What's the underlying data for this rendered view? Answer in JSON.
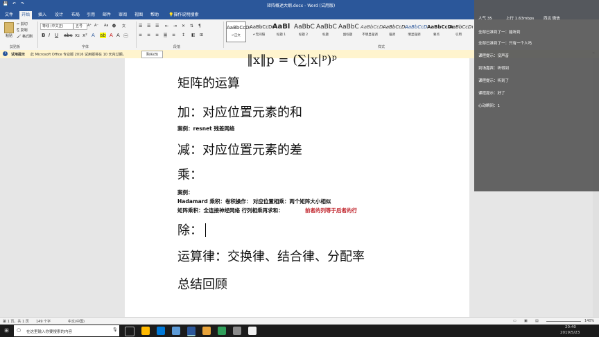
{
  "window": {
    "title": "矩阵概述大纲.docx - Word (试用版)",
    "tabs": [
      "文件",
      "开始",
      "插入",
      "设计",
      "布局",
      "引用",
      "邮件",
      "审阅",
      "视图",
      "帮助",
      "操作说明搜索"
    ],
    "active_tab": "开始"
  },
  "ribbon": {
    "clipboard": {
      "paste": "粘贴",
      "cut": "剪切",
      "copy": "复制",
      "format_painter": "格式刷",
      "group": "剪贴板"
    },
    "font": {
      "name": "等线 (中文正)",
      "size": "五号",
      "group": "字体"
    },
    "paragraph": {
      "group": "段落"
    },
    "styles": {
      "group": "样式",
      "items": [
        {
          "preview": "AaBbCcDı",
          "name": "↵正文"
        },
        {
          "preview": "AaBbCcDı",
          "name": "↵无间隔"
        },
        {
          "preview": "AaBl",
          "name": "标题 1"
        },
        {
          "preview": "AaBbC",
          "name": "标题 2"
        },
        {
          "preview": "AaBbC",
          "name": "标题"
        },
        {
          "preview": "AaBbC",
          "name": "副标题"
        },
        {
          "preview": "AaBbCcDı",
          "name": "不明显强调"
        },
        {
          "preview": "AaBbCcDı",
          "name": "强调"
        },
        {
          "preview": "AaBbCcDı",
          "name": "明显强调"
        },
        {
          "preview": "AaBbCcDı",
          "name": "要点"
        },
        {
          "preview": "AaBbCcDı",
          "name": "引用"
        }
      ]
    }
  },
  "infobar": {
    "label": "试用提示",
    "message": "此 Microsoft Office 专业版 2016 试用版将在 10 天内过期。",
    "button": "购买(B)"
  },
  "document": {
    "formula": "‖x‖p = (∑|x|ᵖ)ᵖ",
    "lines": [
      {
        "text": "矩阵的运算",
        "style": "h1"
      },
      {
        "text": "加：对应位置元素的和",
        "style": "h1"
      },
      {
        "text": "案例：resnet 残差网络",
        "style": "small"
      },
      {
        "text": "减：对应位置元素的差",
        "style": "h1"
      },
      {
        "text": "乘：",
        "style": "h1"
      },
      {
        "text": "案例：",
        "style": "small"
      },
      {
        "text": "Hadamard    乘积：卷积操作：  对应位置相乘：两个矩阵大小相似",
        "style": "small"
      },
      {
        "text": "矩阵乘积：全连接神经网络  行列相乘再求和：",
        "style": "small"
      },
      {
        "text": "前者的列等于后者的行",
        "style": "small-red"
      },
      {
        "text": "除：",
        "style": "h1"
      },
      {
        "text": "运算律：交换律、结合律、分配率",
        "style": "h1"
      },
      {
        "text": "总结回顾",
        "style": "h1"
      }
    ]
  },
  "status": {
    "page": "第 1 页，共 1 页",
    "words": "149 个字",
    "language": "中文(中国)",
    "zoom": "140%"
  },
  "taskbar": {
    "search_placeholder": "在这里输入你要搜索的内容",
    "time": "20:40",
    "date": "2019/5/23"
  },
  "chat_overlay": {
    "header_left": "人气 35",
    "header_mid": "上行 1.63mbps",
    "header_right": "西瓜 微信",
    "messages": [
      "全部已准到了一：能听到",
      "全部已准到了一：只有一个人吗",
      "课程提示：没声音",
      "到场嘉宾：听得到",
      "课程提示：听到了",
      "课程提示：好了",
      "心动瞬间：1"
    ]
  }
}
